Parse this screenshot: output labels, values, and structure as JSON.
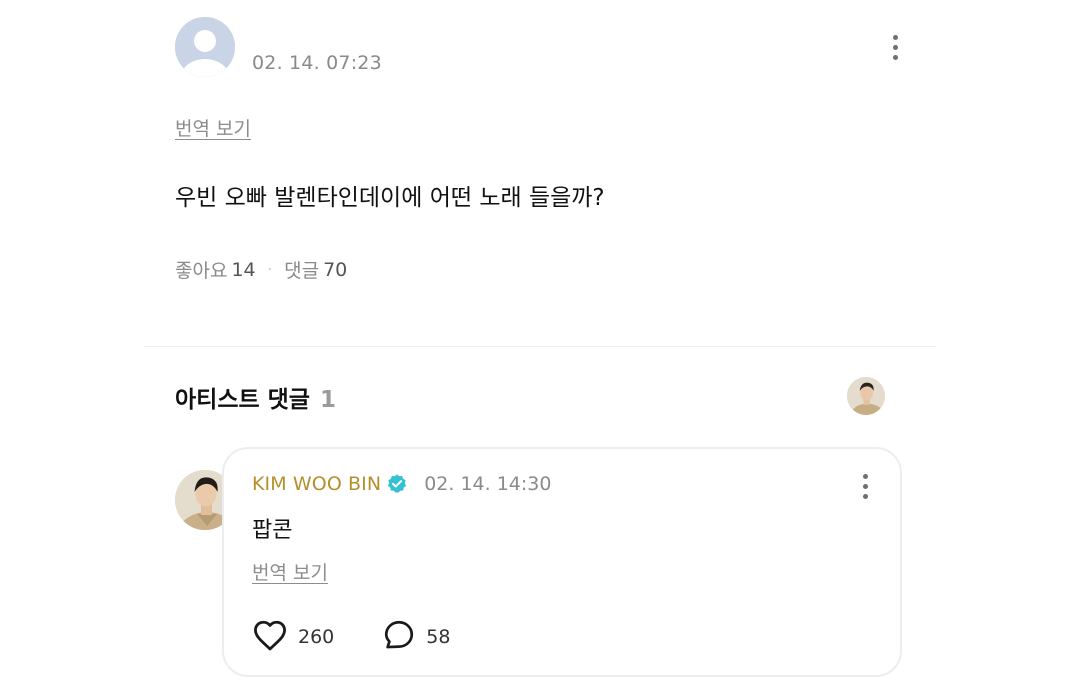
{
  "post": {
    "date": "02. 14. 07:23",
    "translate_label": "번역 보기",
    "body": "우빈 오빠 발렌타인데이에 어떤 노래 들을까?",
    "likes_label": "좋아요",
    "likes_count": "14",
    "separator": "·",
    "comments_label": "댓글",
    "comments_count": "70"
  },
  "artist_comments": {
    "heading": "아티스트 댓글",
    "count": "1",
    "items": [
      {
        "author": "KIM WOO BIN",
        "date": "02. 14. 14:30",
        "body": "팝콘",
        "translate_label": "번역 보기",
        "like_count": "260",
        "reply_count": "58"
      }
    ]
  },
  "icons": {
    "post_more": "more-vertical-icon",
    "comment_more": "more-vertical-icon",
    "verified": "verified-badge-icon",
    "like": "heart-icon",
    "reply": "comment-bubble-icon"
  },
  "colors": {
    "author": "#b5902a",
    "verified": "#35c0d3",
    "muted": "#8a8a8a"
  }
}
